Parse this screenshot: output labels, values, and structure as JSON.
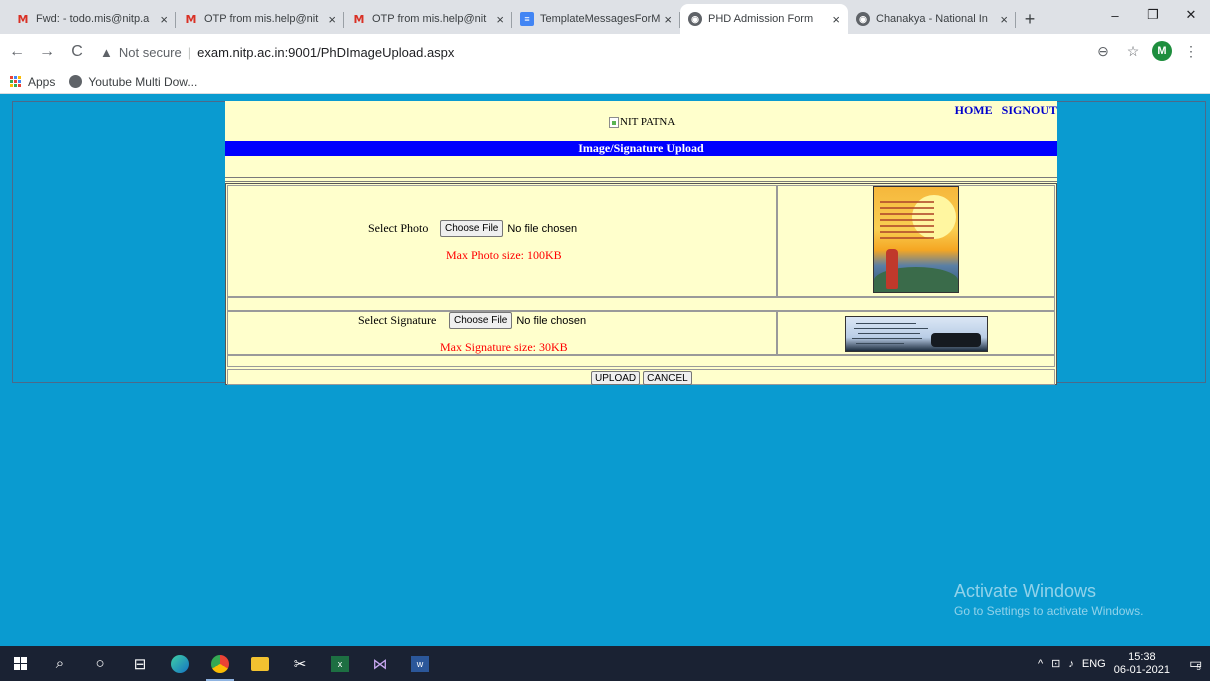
{
  "browser": {
    "tabs": [
      {
        "icon": "gmail-icon",
        "title": "Fwd: - todo.mis@nitp.a"
      },
      {
        "icon": "gmail-icon",
        "title": "OTP from mis.help@nit"
      },
      {
        "icon": "gmail-icon",
        "title": "OTP from mis.help@nit"
      },
      {
        "icon": "docs-icon",
        "title": "TemplateMessagesForM"
      },
      {
        "icon": "globe-icon",
        "title": "PHD Admission Form",
        "active": true
      },
      {
        "icon": "globe-icon",
        "title": "Chanakya - National In"
      }
    ],
    "tab_close": "×",
    "new_tab": "+",
    "window_controls": {
      "minimize": "–",
      "restore": "❐",
      "close": "✕"
    },
    "nav": {
      "back": "←",
      "forward": "→",
      "reload": "C"
    },
    "security_label": "Not secure",
    "url": "exam.nitp.ac.in:9001/PhDImageUpload.aspx",
    "profile_initial": "M",
    "bookmarks": [
      {
        "label": "Apps"
      },
      {
        "label": "Youtube Multi Dow..."
      }
    ]
  },
  "page": {
    "links": {
      "home": "HOME",
      "signout": "SIGNOUT"
    },
    "logo_alt": "NIT PATNA",
    "title": "Image/Signature Upload",
    "photo": {
      "label": "Select Photo",
      "button": "Choose File",
      "status": "No file chosen",
      "note": "Max Photo size: 100KB"
    },
    "signature": {
      "label": "Select Signature",
      "button": "Choose File",
      "status": "No file chosen",
      "note": "Max Signature size: 30KB"
    },
    "actions": {
      "upload": "UPLOAD",
      "cancel": "CANCEL"
    },
    "colors": {
      "panel": "#ffffcc",
      "title_bar": "#0000ff",
      "background": "#0a9bd0",
      "note": "#ff0000"
    }
  },
  "watermark": {
    "title": "Activate Windows",
    "subtitle": "Go to Settings to activate Windows."
  },
  "taskbar": {
    "language": "ENG",
    "time": "15:38",
    "date": "06-01-2021",
    "notifications": "5"
  }
}
